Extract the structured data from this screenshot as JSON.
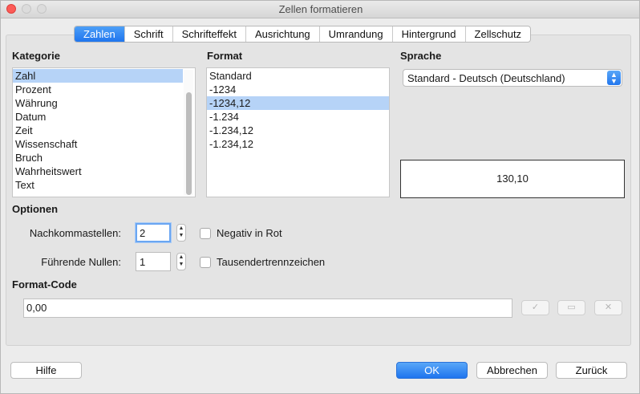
{
  "window": {
    "title": "Zellen formatieren"
  },
  "tabs": [
    {
      "label": "Zahlen",
      "active": true
    },
    {
      "label": "Schrift",
      "active": false
    },
    {
      "label": "Schrifteffekt",
      "active": false
    },
    {
      "label": "Ausrichtung",
      "active": false
    },
    {
      "label": "Umrandung",
      "active": false
    },
    {
      "label": "Hintergrund",
      "active": false
    },
    {
      "label": "Zellschutz",
      "active": false
    }
  ],
  "kategorie": {
    "heading": "Kategorie",
    "items": [
      "Zahl",
      "Prozent",
      "Währung",
      "Datum",
      "Zeit",
      "Wissenschaft",
      "Bruch",
      "Wahrheitswert",
      "Text"
    ],
    "selected": "Zahl"
  },
  "format": {
    "heading": "Format",
    "items": [
      "Standard",
      "-1234",
      "-1234,12",
      "-1.234",
      "-1.234,12",
      "-1.234,12"
    ],
    "selected": "-1234,12"
  },
  "sprache": {
    "heading": "Sprache",
    "value": "Standard - Deutsch (Deutschland)"
  },
  "preview": {
    "value": "130,10"
  },
  "optionen": {
    "heading": "Optionen",
    "nachkommastellen_label": "Nachkommastellen:",
    "nachkommastellen_value": "2",
    "fuehrende_nullen_label": "Führende Nullen:",
    "fuehrende_nullen_value": "1",
    "negativ_in_rot": {
      "label": "Negativ in Rot",
      "checked": false
    },
    "tausendertrennzeichen": {
      "label": "Tausendertrennzeichen",
      "checked": false
    }
  },
  "format_code": {
    "heading": "Format-Code",
    "value": "0,00",
    "buttons": [
      "checkmark-icon",
      "comment-icon",
      "delete-icon"
    ]
  },
  "footer": {
    "help": "Hilfe",
    "ok": "OK",
    "cancel": "Abbrechen",
    "reset": "Zurück"
  },
  "colors": {
    "accent": "#1f75ee",
    "selection": "#b6d3f7",
    "close": "#fc5b57"
  }
}
